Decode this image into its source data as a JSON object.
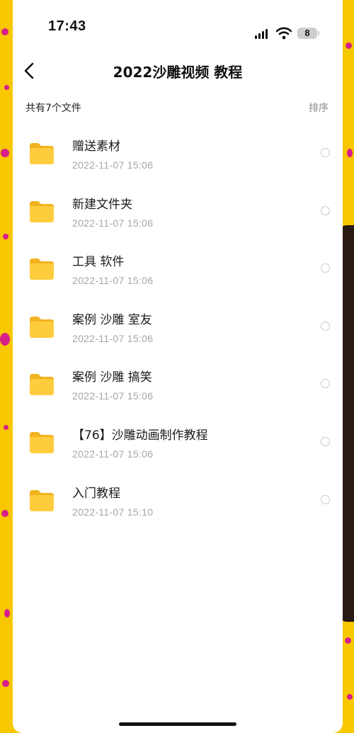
{
  "status_bar": {
    "time": "17:43",
    "battery": "8"
  },
  "nav": {
    "title": "2022沙雕视频 教程"
  },
  "list_header": {
    "count": "共有7个文件",
    "sort": "排序"
  },
  "files": [
    {
      "name": "赠送素材",
      "date": "2022-11-07 15:06"
    },
    {
      "name": "新建文件夹",
      "date": "2022-11-07 15:06"
    },
    {
      "name": "工具 软件",
      "date": "2022-11-07 15:06"
    },
    {
      "name": "案例 沙雕 室友",
      "date": "2022-11-07 15:06"
    },
    {
      "name": "案例 沙雕 搞笑",
      "date": "2022-11-07 15:06"
    },
    {
      "name": "【76】沙雕动画制作教程",
      "date": "2022-11-07 15:06"
    },
    {
      "name": "入门教程",
      "date": "2022-11-07 15:10"
    }
  ],
  "icons": [
    "back-arrow-icon",
    "signal-icon",
    "wifi-icon",
    "battery-icon",
    "folder-icon",
    "radio-icon"
  ],
  "colors": {
    "background": "#f7c800",
    "folder": "#ffc83a",
    "dots": "#d61f8a"
  }
}
